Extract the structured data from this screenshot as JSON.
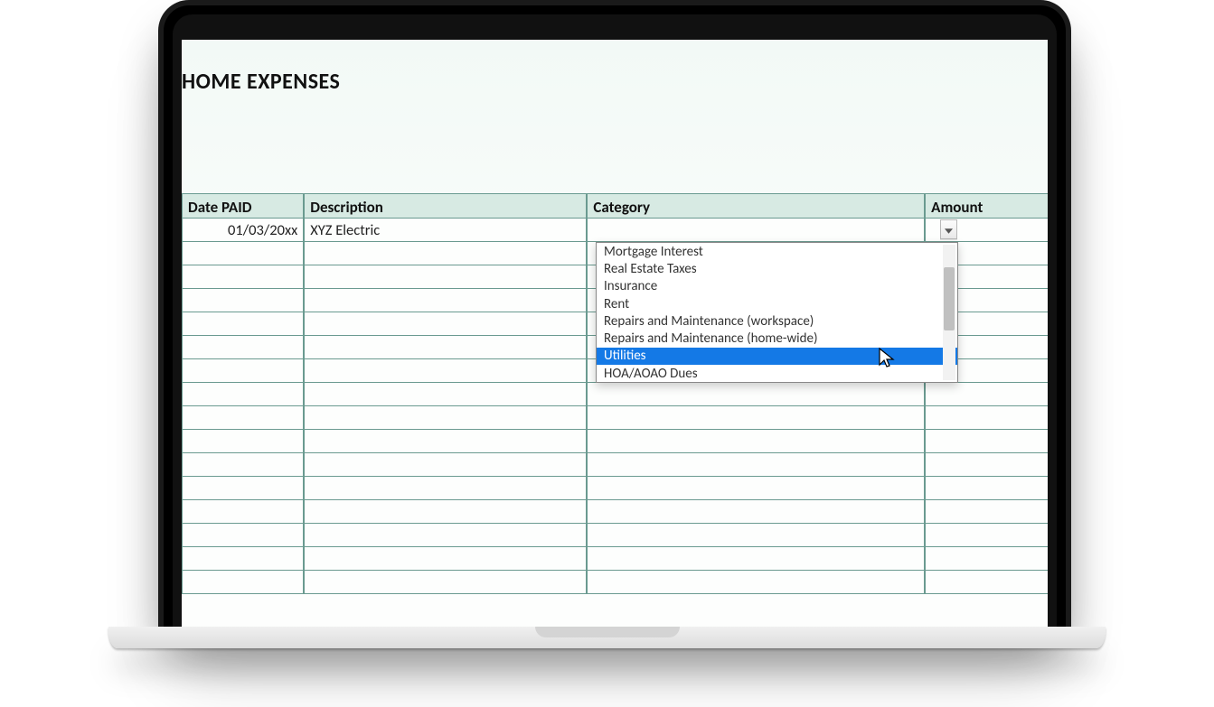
{
  "title": "HOME EXPENSES",
  "columns": {
    "date": "Date PAID",
    "description": "Description",
    "category": "Category",
    "amount": "Amount"
  },
  "row": {
    "date": "01/03/20xx",
    "description": "XYZ Electric",
    "category": "",
    "amount": ""
  },
  "dropdown": {
    "options": [
      "Mortgage Interest",
      "Real Estate Taxes",
      "Insurance",
      "Rent",
      "Repairs and Maintenance (workspace)",
      "Repairs and Maintenance (home-wide)",
      "Utilities",
      "HOA/AOAO Dues"
    ],
    "highlighted": "Utilities"
  }
}
